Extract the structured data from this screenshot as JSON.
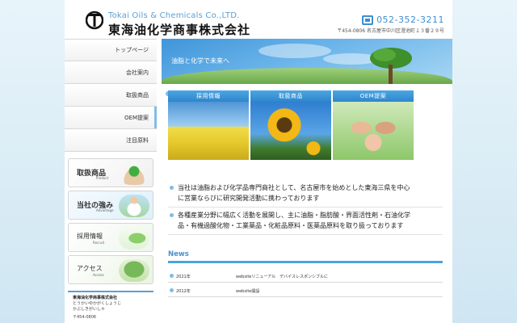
{
  "header": {
    "company_en": "Tokai Oils & Chemicals Co.,LTD.",
    "company_jp": "東海油化学商事株式会社",
    "phone": "052-352-3211",
    "address": "〒454-0806 名古屋市中川区澄池町１３番２９号"
  },
  "nav": {
    "items": [
      {
        "label": "トップページ"
      },
      {
        "label": "会社案内"
      },
      {
        "label": "取扱商品"
      },
      {
        "label": "OEM提案"
      },
      {
        "label": "注目原料"
      }
    ]
  },
  "banners": [
    {
      "title": "取扱商品",
      "sub": "Product"
    },
    {
      "title": "当社の強み",
      "sub": "Advantage"
    },
    {
      "title": "採用情報",
      "sub": "Recruit"
    },
    {
      "title": "アクセス",
      "sub": "Access"
    }
  ],
  "sidebox": {
    "name": "東海油化学商事株式会社",
    "kana1": "とうかいゆかがくしょうじ",
    "kana2": "かぶしきがいしゃ",
    "postal": "〒454-0806"
  },
  "hero": {
    "tagline": "油脂と化学で未来へ"
  },
  "tiles": [
    {
      "label": "採用情報"
    },
    {
      "label": "取扱商品"
    },
    {
      "label": "OEM提案"
    }
  ],
  "info": [
    {
      "line1": "当社は油脂および化学品専門商社として、名古屋市を始めとした東海三県を中心",
      "line2": "に営業ならびに研究開発活動に携わっております"
    },
    {
      "line1": "各種産業分野に幅広く活動を展開し、主に油脂・脂肪酸・界面活性剤・石油化学",
      "line2": "品・有機過酸化物・工業薬品・化粧品原料・医薬品原料を取り扱っております"
    }
  ],
  "news": {
    "title": "News",
    "items": [
      {
        "date": "2021年",
        "text": "websiteリニューアル　デバイスレスポンシブルに"
      },
      {
        "date": "2012年",
        "text": "website開設"
      }
    ]
  }
}
